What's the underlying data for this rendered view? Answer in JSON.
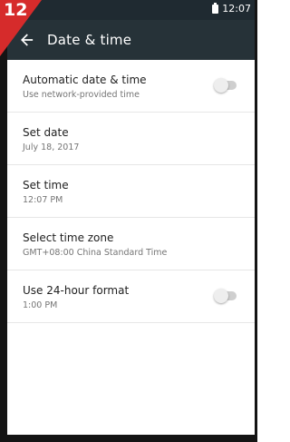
{
  "badge": {
    "number": "12"
  },
  "status_bar": {
    "time": "12:07",
    "battery_icon": "battery-icon"
  },
  "toolbar": {
    "title": "Date & time",
    "back_icon": "arrow-back-icon"
  },
  "settings": [
    {
      "label": "Automatic date & time",
      "summary": "Use network-provided time",
      "toggle": false
    },
    {
      "label": "Set date",
      "summary": "July 18, 2017"
    },
    {
      "label": "Set time",
      "summary": "12:07 PM"
    },
    {
      "label": "Select time zone",
      "summary": "GMT+08:00 China Standard Time"
    },
    {
      "label": "Use 24-hour format",
      "summary": "1:00 PM",
      "toggle": false
    }
  ],
  "colors": {
    "toolbar": "#263238",
    "statusbar": "#1f2a31",
    "badge": "#d62b2b"
  }
}
